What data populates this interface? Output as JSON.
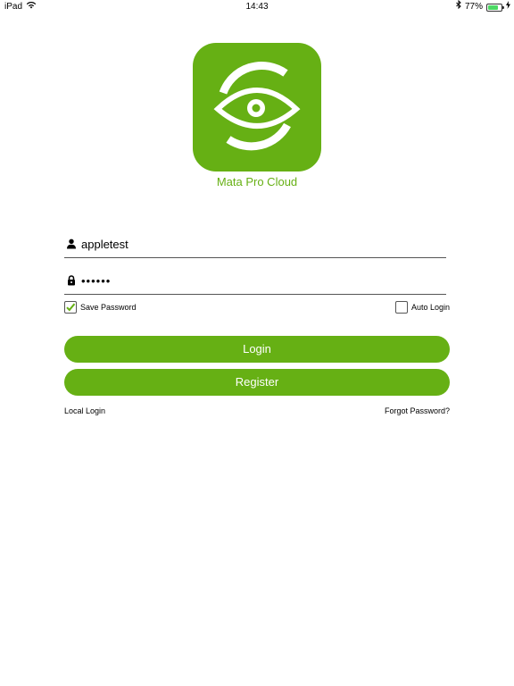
{
  "status_bar": {
    "device": "iPad",
    "time": "14:43",
    "battery_text": "77%",
    "battery_level": 0.77,
    "icons": [
      "wifi-icon",
      "bluetooth-icon",
      "battery-icon",
      "charging-icon"
    ]
  },
  "app": {
    "name": "Mata Pro Cloud",
    "brand_color": "#66b014",
    "logo_icon": "eye-icon"
  },
  "login_form": {
    "username": {
      "value": "appletest",
      "icon": "user-icon"
    },
    "password": {
      "value": "••••••",
      "icon": "lock-icon"
    },
    "save_password": {
      "label": "Save Password",
      "checked": true
    },
    "auto_login": {
      "label": "Auto Login",
      "checked": false
    },
    "login_label": "Login",
    "register_label": "Register",
    "local_login_label": "Local Login",
    "forgot_password_label": "Forgot Password?"
  }
}
